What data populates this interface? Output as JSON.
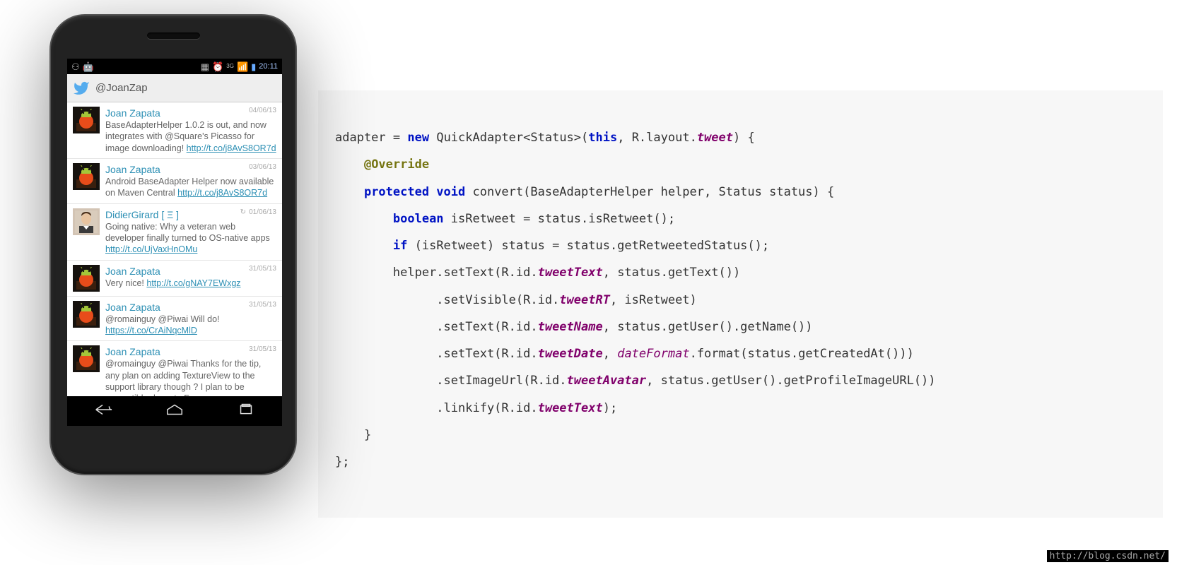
{
  "status_bar": {
    "voicemail_icon": "⚇",
    "android_icon": "◧",
    "time": "20:11"
  },
  "header": {
    "handle": "@JoanZap"
  },
  "tweets": [
    {
      "name": "Joan Zapata",
      "date": "04/06/13",
      "text_pre": "BaseAdapterHelper 1.0.2 is out, and now integrates with @Square's Picasso for image downloading! ",
      "link": "http://t.co/j8AvS8OR7d",
      "retweet": false,
      "avatar_type": "droid"
    },
    {
      "name": "Joan Zapata",
      "date": "03/06/13",
      "text_pre": "Android BaseAdapter Helper now available on Maven Central ",
      "link": "http://t.co/j8AvS8OR7d",
      "retweet": false,
      "avatar_type": "droid"
    },
    {
      "name": "DidierGirard  [ Ξ ]",
      "date": "01/06/13",
      "text_pre": "Going native: Why a veteran web developer finally turned to OS-native apps ",
      "link": "http://t.co/UjVaxHnOMu",
      "retweet": true,
      "avatar_type": "person"
    },
    {
      "name": "Joan Zapata",
      "date": "31/05/13",
      "text_pre": "Very nice! ",
      "link": "http://t.co/gNAY7EWxgz",
      "retweet": false,
      "avatar_type": "droid"
    },
    {
      "name": "Joan Zapata",
      "date": "31/05/13",
      "text_pre": "@romainguy @Piwai Will do! ",
      "link": "https://t.co/CrAiNqcMlD",
      "retweet": false,
      "avatar_type": "droid"
    },
    {
      "name": "Joan Zapata",
      "date": "31/05/13",
      "text_pre": "@romainguy @Piwai Thanks for the tip, any plan on adding TextureView to the support library though ? I plan to be compatible down to Froyo.",
      "link": "",
      "retweet": false,
      "avatar_type": "droid"
    }
  ],
  "code": {
    "l1a": "new",
    "l1b": " QuickAdapter<Status>(",
    "l1c": "this",
    "l1d": ", R.layout.",
    "l1e": "tweet",
    "l1f": ") {",
    "l2a": "@Override",
    "l3a": "protected void",
    "l3b": " convert(BaseAdapterHelper helper, Status status) {",
    "l4a": "boolean",
    "l4b": " isRetweet = status.isRetweet();",
    "l5a": "if",
    "l5b": " (isRetweet) status = status.getRetweetedStatus();",
    "l6a": "helper.setText(R.id.",
    "l6b": "tweetText",
    "l6c": ", status.getText())",
    "l7a": ".setVisible(R.id.",
    "l7b": "tweetRT",
    "l7c": ", isRetweet)",
    "l8a": ".setText(R.id.",
    "l8b": "tweetName",
    "l8c": ", status.getUser().getName())",
    "l9a": ".setText(R.id.",
    "l9b": "tweetDate",
    "l9c": ", ",
    "l9d": "dateFormat",
    "l9e": ".format(status.getCreatedAt()))",
    "l10a": ".setImageUrl(R.id.",
    "l10b": "tweetAvatar",
    "l10c": ", status.getUser().getProfileImageURL())",
    "l11a": ".linkify(R.id.",
    "l11b": "tweetText",
    "l11c": ");",
    "l12": "}",
    "l13": "};"
  },
  "watermark": "http://blog.csdn.net/"
}
